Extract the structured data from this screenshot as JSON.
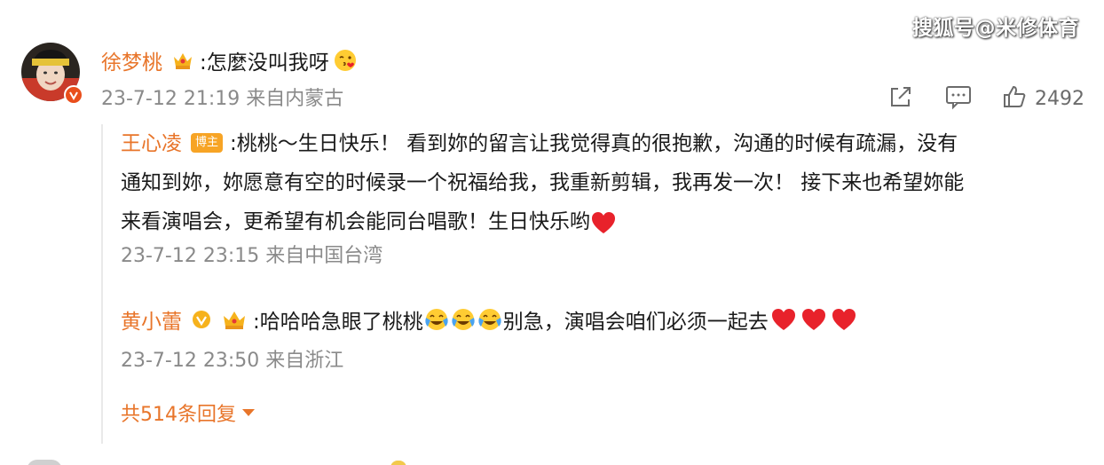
{
  "watermark": "搜狐号@米修体育",
  "comment": {
    "username": "徐梦桃",
    "text": ":怎麼没叫我呀",
    "emoji": "kiss-emoji",
    "timestamp": "23-7-12 21:19",
    "location": "来自内蒙古",
    "likes": "2492",
    "icons": [
      "share-icon",
      "comment-icon",
      "like-icon"
    ]
  },
  "replies": [
    {
      "username": "王心凌",
      "badge": "博主",
      "lines": [
        ":桃桃～生日快乐！ 看到妳的留言让我觉得真的很抱歉，沟通的时候有疏漏，没有",
        "通知到妳，妳愿意有空的时候录一个祝福给我，我重新剪辑，我再发一次！ 接下来也希望妳能",
        "来看演唱会，更希望有机会能同台唱歌！生日快乐哟"
      ],
      "timestamp": "23-7-12 23:15",
      "location": "来自中国台湾"
    },
    {
      "username": "黄小蕾",
      "text_a": ":哈哈哈急眼了桃桃",
      "text_b": "别急，演唱会咱们必须一起去",
      "timestamp": "23-7-12 23:50",
      "location": "来自浙江"
    }
  ],
  "more_replies": "共514条回复",
  "colors": {
    "accent": "#e8752a",
    "muted": "#8a8a8a",
    "heart": "#e8222b",
    "badge": "#f7a425"
  }
}
